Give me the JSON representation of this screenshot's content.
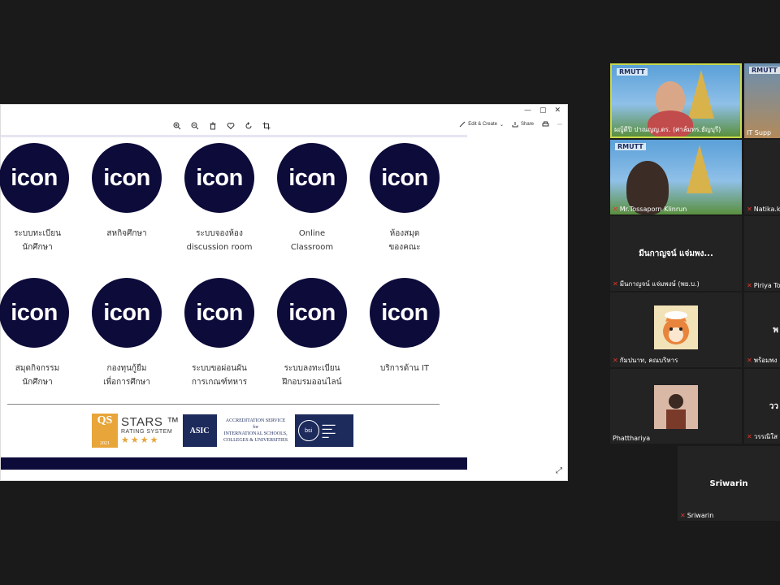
{
  "window": {
    "controls": [
      "—",
      "▢",
      "✕"
    ]
  },
  "toolbar": {
    "edit_create": "Edit & Create",
    "share": "Share",
    "more": "⋯"
  },
  "slide": {
    "icon_text": "icon",
    "row1": [
      {
        "line1": "ระบบทะเบียน",
        "line2": "นักศึกษา"
      },
      {
        "line1": "สหกิจศึกษา",
        "line2": ""
      },
      {
        "line1": "ระบบจองห้อง",
        "line2": "discussion room"
      },
      {
        "line1": "Online",
        "line2": "Classroom"
      },
      {
        "line1": "ห้องสมุด",
        "line2": "ของคณะ"
      }
    ],
    "row2": [
      {
        "line1": "สมุดกิจกรรม",
        "line2": "นักศึกษา"
      },
      {
        "line1": "กองทุนกู้ยืม",
        "line2": "เพื่อการศึกษา"
      },
      {
        "line1": "ระบบขอผ่อนผัน",
        "line2": "การเกณฑ์ทหาร"
      },
      {
        "line1": "ระบบลงทะเบียน",
        "line2": "ฝึกอบรมออนไลน์"
      },
      {
        "line1": "บริการด้าน IT",
        "line2": ""
      }
    ],
    "logos": {
      "qs_mark": "QS",
      "qs_year": "2021",
      "qs_title": "STARS ™",
      "qs_sub": "RATING SYSTEM",
      "qs_stars": "★★★★",
      "asic_mark": "ASIC",
      "asic_line1": "ACCREDITATION SERVICE",
      "asic_line2": "for",
      "asic_line3": "INTERNATIONAL SCHOOLS,",
      "asic_line4": "COLLEGES & UNIVERSITIES",
      "bsi_mark": "bsi"
    }
  },
  "participants": [
    {
      "name": "ผญู้ดีปิ ปาณญญ.ดร. (ศาล์มทร.ธัญบุรี)",
      "video": true,
      "muted": false
    },
    {
      "name": "IT Supp",
      "video": true,
      "muted": false
    },
    {
      "name": "Mr.Tossaporn Klinrun",
      "video": true,
      "muted": true
    },
    {
      "name": "Natika.k",
      "video": false,
      "muted": true
    },
    {
      "name": "มีนกาญจน์ แจ่มพง...",
      "caption": "มีนกาญจน์ แจ่มพงษ์ (พย.บ.)",
      "video": false,
      "muted": true
    },
    {
      "name": "Piriya To",
      "video": false,
      "muted": true
    },
    {
      "name": "กัมปนาท, คณบริหาร",
      "video": false,
      "muted": true
    },
    {
      "name": "พร้อมพง",
      "big": "พ",
      "video": false,
      "muted": true
    },
    {
      "name": "Phatthariya",
      "video": false,
      "muted": false
    },
    {
      "name": "วรรณิใส",
      "big": "วว",
      "video": false,
      "muted": true
    },
    {
      "name": "Sriwarin",
      "big": "Sriwarin",
      "video": false,
      "muted": true
    }
  ],
  "colors": {
    "navy": "#0d0b3a",
    "background": "#1a1a1a",
    "tile": "#232323",
    "active_speaker_border": "#c8d84a",
    "muted": "#e0352b"
  }
}
